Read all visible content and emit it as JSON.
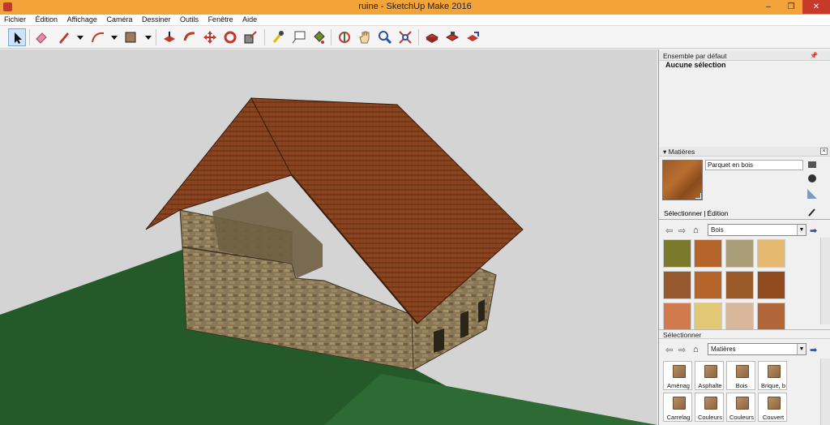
{
  "window": {
    "title": "ruine - SketchUp Make 2016",
    "minimize": "–",
    "restore": "❐",
    "close": "✕"
  },
  "menu": [
    "Fichier",
    "Édition",
    "Affichage",
    "Caméra",
    "Dessiner",
    "Outils",
    "Fenêtre",
    "Aide"
  ],
  "toolbar": {
    "tools": [
      "select-tool",
      "eraser-tool",
      "pencil-tool",
      "arc-tool",
      "rectangle-tool",
      "push-pull-tool",
      "offset-tool",
      "move-tool",
      "rotate-tool",
      "scale-tool",
      "tape-measure-tool",
      "text-tool",
      "paint-bucket-tool",
      "orbit-tool",
      "pan-tool",
      "zoom-tool",
      "zoom-extents-tool",
      "warehouse-tool",
      "extension-warehouse-tool",
      "share-model-tool"
    ]
  },
  "tray": {
    "title": "Ensemble par défaut",
    "entity_info": "Aucune sélection",
    "materials": {
      "title": "Matières",
      "current_material": "Parquet en bois",
      "tabs": [
        "Sélectionner",
        "Édition"
      ],
      "collection": "Bois",
      "swatches": [
        "#7b7a2c",
        "#b4642a",
        "#a89d76",
        "#e6b970",
        "#96582e",
        "#b6652a",
        "#9b5a2a",
        "#914a1e",
        "#d07a4e",
        "#e2c774",
        "#d8b69a",
        "#b1663a"
      ],
      "secondary_header": "Sélectionner",
      "secondary_collection": "Matières",
      "folders": [
        "Aménag",
        "Asphalte",
        "Bois",
        "Brique, b",
        "Carrelag",
        "Couleurs",
        "Couleurs",
        "Couvert"
      ]
    }
  },
  "colors": {
    "titlebar": "#f2a33a",
    "ground": "#245a2a",
    "sky": "#d4d4d4",
    "roof": "#8a4520",
    "stone": "#8e7b57"
  }
}
